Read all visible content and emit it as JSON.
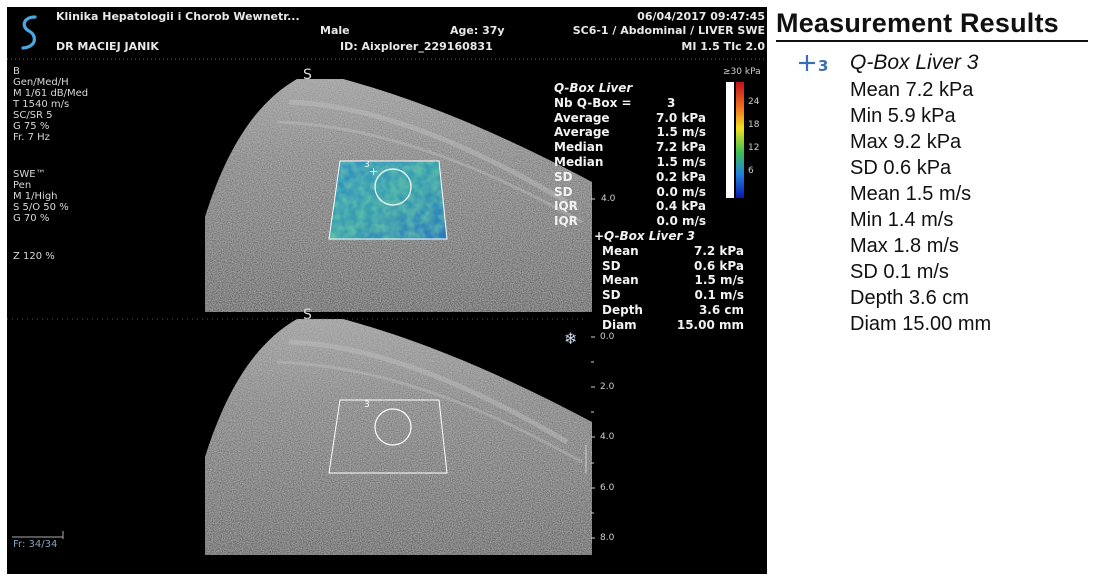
{
  "header": {
    "clinic": "Klinika Hepatologii i Chorob Wewnetr...",
    "doctor": "DR MACIEJ JANIK",
    "sex": "Male",
    "age": "Age: 37y",
    "id": "ID: Aixplorer_229160831",
    "datetime": "06/04/2017 09:47:45",
    "probe": "SC6-1 / Abdominal / LIVER SWE",
    "mi": "MI 1.5  TIc  2.0"
  },
  "left_params": {
    "b_block": [
      "B",
      "Gen/Med/H",
      "M 1/61 dB/Med",
      "T 1540 m/s",
      "SC/SR 5",
      "G 75 %",
      "Fr. 7 Hz"
    ],
    "swe_block": [
      "SWE™",
      "Pen",
      "M 1/High",
      "S 5/O 50 %",
      "G 70 %"
    ],
    "zoom": "Z 120  %",
    "frame": "Fr: 34/34"
  },
  "color_scale": {
    "unit": "≥30 kPa",
    "labels": [
      "24",
      "18",
      "12",
      "6"
    ]
  },
  "qbox_summary": {
    "title": "Q-Box Liver",
    "rows": [
      {
        "k": "Nb Q-Box =",
        "v": "3"
      },
      {
        "k": "Average",
        "v": "7.0 kPa"
      },
      {
        "k": "Average",
        "v": "1.5 m/s"
      },
      {
        "k": "Median",
        "v": "7.2 kPa"
      },
      {
        "k": "Median",
        "v": "1.5 m/s"
      },
      {
        "k": "SD",
        "v": "0.2 kPa"
      },
      {
        "k": "SD",
        "v": "0.0 m/s"
      },
      {
        "k": "IQR",
        "v": "0.4 kPa"
      },
      {
        "k": "IQR",
        "v": "0.0 m/s"
      }
    ]
  },
  "qbox3": {
    "title": "+Q-Box Liver 3",
    "rows": [
      {
        "k": "Mean",
        "v": "7.2 kPa"
      },
      {
        "k": "SD",
        "v": "0.6 kPa"
      },
      {
        "k": "Mean",
        "v": "1.5 m/s"
      },
      {
        "k": "SD",
        "v": "0.1 m/s"
      },
      {
        "k": "Depth",
        "v": "3.6 cm"
      },
      {
        "k": "Diam",
        "v": "15.00 mm"
      }
    ]
  },
  "depth_ticks_top": [
    "4.0"
  ],
  "depth_ticks_bottom": [
    "0.0",
    "2.0",
    "4.0",
    "6.0",
    "8.0"
  ],
  "results_panel": {
    "title": "Measurement Results",
    "icon": "plus-3-icon",
    "qbox_name": "Q-Box Liver 3",
    "lines": [
      "Mean 7.2 kPa",
      "Min 5.9 kPa",
      "Max 9.2 kPa",
      "SD 0.6 kPa",
      "Mean 1.5 m/s",
      "Min 1.4 m/s",
      "Max 1.8 m/s",
      "SD 0.1 m/s",
      "Depth 3.6 cm",
      "Diam 15.00 mm"
    ]
  },
  "colors": {
    "scale_high": "#c0101a",
    "scale_mid": "#f0e020",
    "scale_low": "#0818b0",
    "swe_box": "#3a90c0"
  }
}
